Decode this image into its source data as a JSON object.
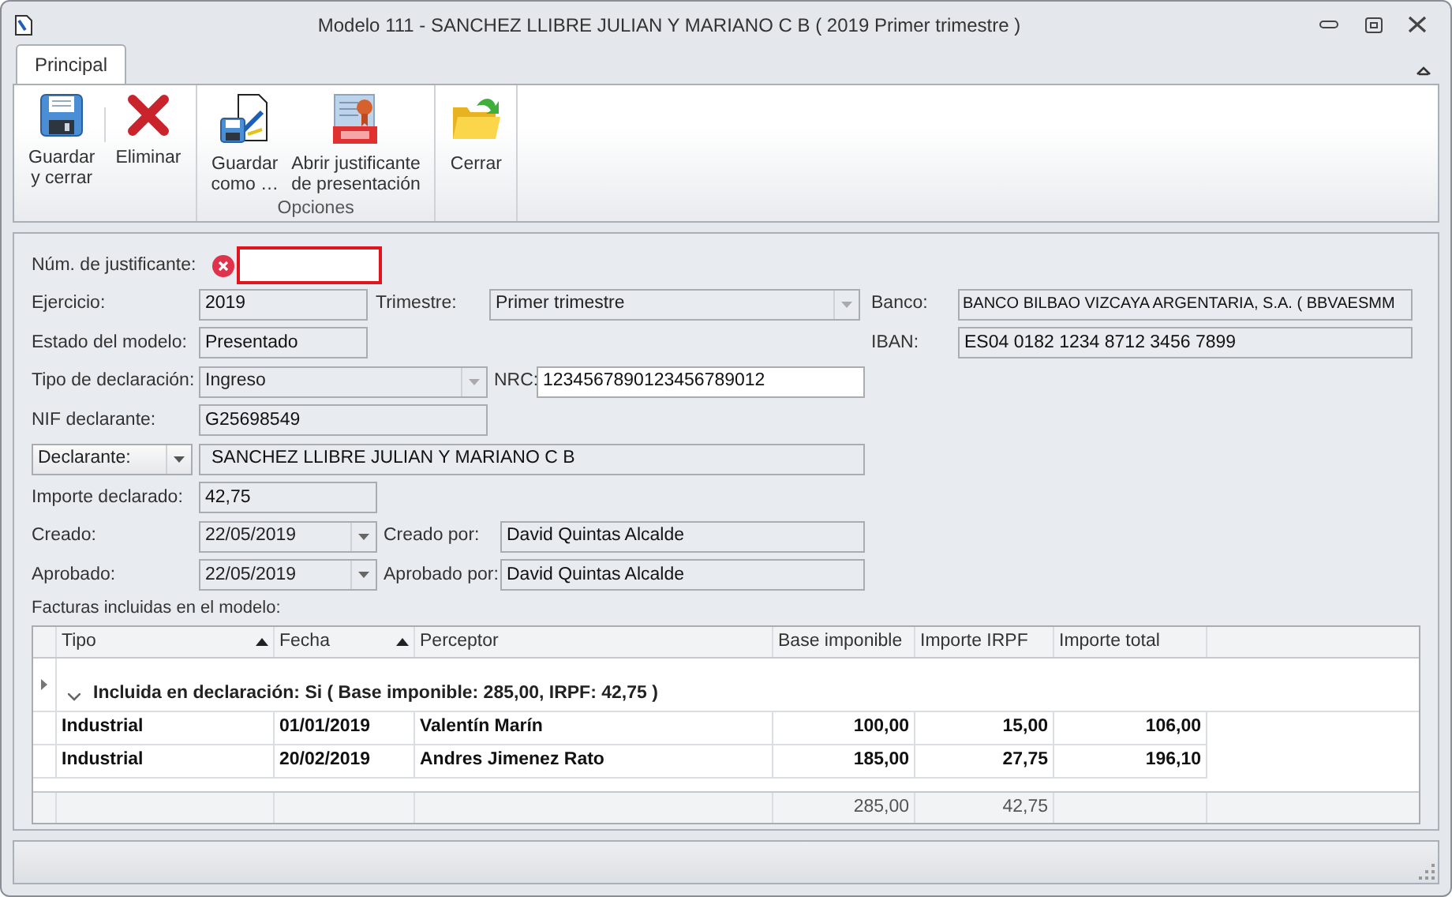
{
  "window": {
    "title": "Modelo 111 -  SANCHEZ LLIBRE JULIAN Y MARIANO C B ( 2019 Primer trimestre )"
  },
  "tabs": [
    {
      "label": "Principal",
      "selected": true
    }
  ],
  "ribbon_groups": [
    {
      "buttons": [
        {
          "label": "Guardar\ny cerrar"
        },
        {
          "label": "Eliminar"
        }
      ]
    },
    {
      "label": "Opciones",
      "buttons": [
        {
          "label": "Guardar\ncomo …"
        },
        {
          "label": "Abrir justificante\nde presentación"
        }
      ]
    },
    {
      "buttons": [
        {
          "label": "Cerrar"
        }
      ]
    }
  ],
  "form": {
    "justificante": {
      "label": "Núm. de justificante:",
      "error": true
    },
    "ejercicio": {
      "label": "Ejercicio:",
      "value": "2019",
      "readonly": true
    },
    "trimestre": {
      "label": "Trimestre:",
      "value": "Primer trimestre",
      "readonly": true
    },
    "banco": {
      "label": "Banco:",
      "value": "BANCO BILBAO VIZCAYA ARGENTARIA, S.A. ( BBVAESMM",
      "readonly": true
    },
    "estado": {
      "label": "Estado del modelo:",
      "value": "Presentado",
      "readonly": true
    },
    "iban": {
      "label": "IBAN:",
      "value": "ES04 0182 1234 8712 3456 7899",
      "readonly": true
    },
    "tipo": {
      "label": "Tipo de declaración:",
      "value": "Ingreso",
      "readonly": true
    },
    "nrc": {
      "label": "NRC:",
      "value": "1234567890123456789012",
      "readonly": false
    },
    "nif": {
      "label": "NIF declarante:",
      "value": "G25698549",
      "readonly": true
    },
    "declarante": {
      "label": "Declarante:",
      "value": "SANCHEZ LLIBRE JULIAN Y MARIANO C B",
      "readonly": true
    },
    "importe": {
      "label": "Importe declarado:",
      "value": "42,75",
      "readonly": true
    },
    "creado": {
      "label": "Creado:",
      "value": "22/05/2019",
      "readonly": true
    },
    "creado_por": {
      "label": "Creado por:",
      "value": "David Quintas Alcalde",
      "readonly": true
    },
    "aprobado": {
      "label": "Aprobado:",
      "value": "22/05/2019",
      "readonly": true
    },
    "aprobado_por": {
      "label": "Aprobado por:",
      "value": "David Quintas Alcalde",
      "readonly": true
    }
  },
  "grid": {
    "caption": "Facturas incluidas en el modelo:",
    "columns": [
      {
        "label": "Tipo",
        "sorted": true
      },
      {
        "label": "Fecha",
        "sorted": true
      },
      {
        "label": "Perceptor",
        "sorted": false
      },
      {
        "label": "Base imponible",
        "sorted": false
      },
      {
        "label": "Importe IRPF",
        "sorted": false
      },
      {
        "label": "Importe total",
        "sorted": false
      }
    ],
    "group": {
      "label": "Incluida en declaración: Si ( Base imponible: 285,00,  IRPF: 42,75 )",
      "expanded": true
    },
    "rows": [
      {
        "cells": [
          "Industrial",
          "01/01/2019",
          "Valentín Marín",
          "100,00",
          "15,00",
          "106,00"
        ]
      },
      {
        "cells": [
          "Industrial",
          "20/02/2019",
          "Andres Jimenez Rato",
          "185,00",
          "27,75",
          "196,10"
        ]
      }
    ],
    "totals": {
      "base": "285,00",
      "irpf": "42,75"
    }
  }
}
